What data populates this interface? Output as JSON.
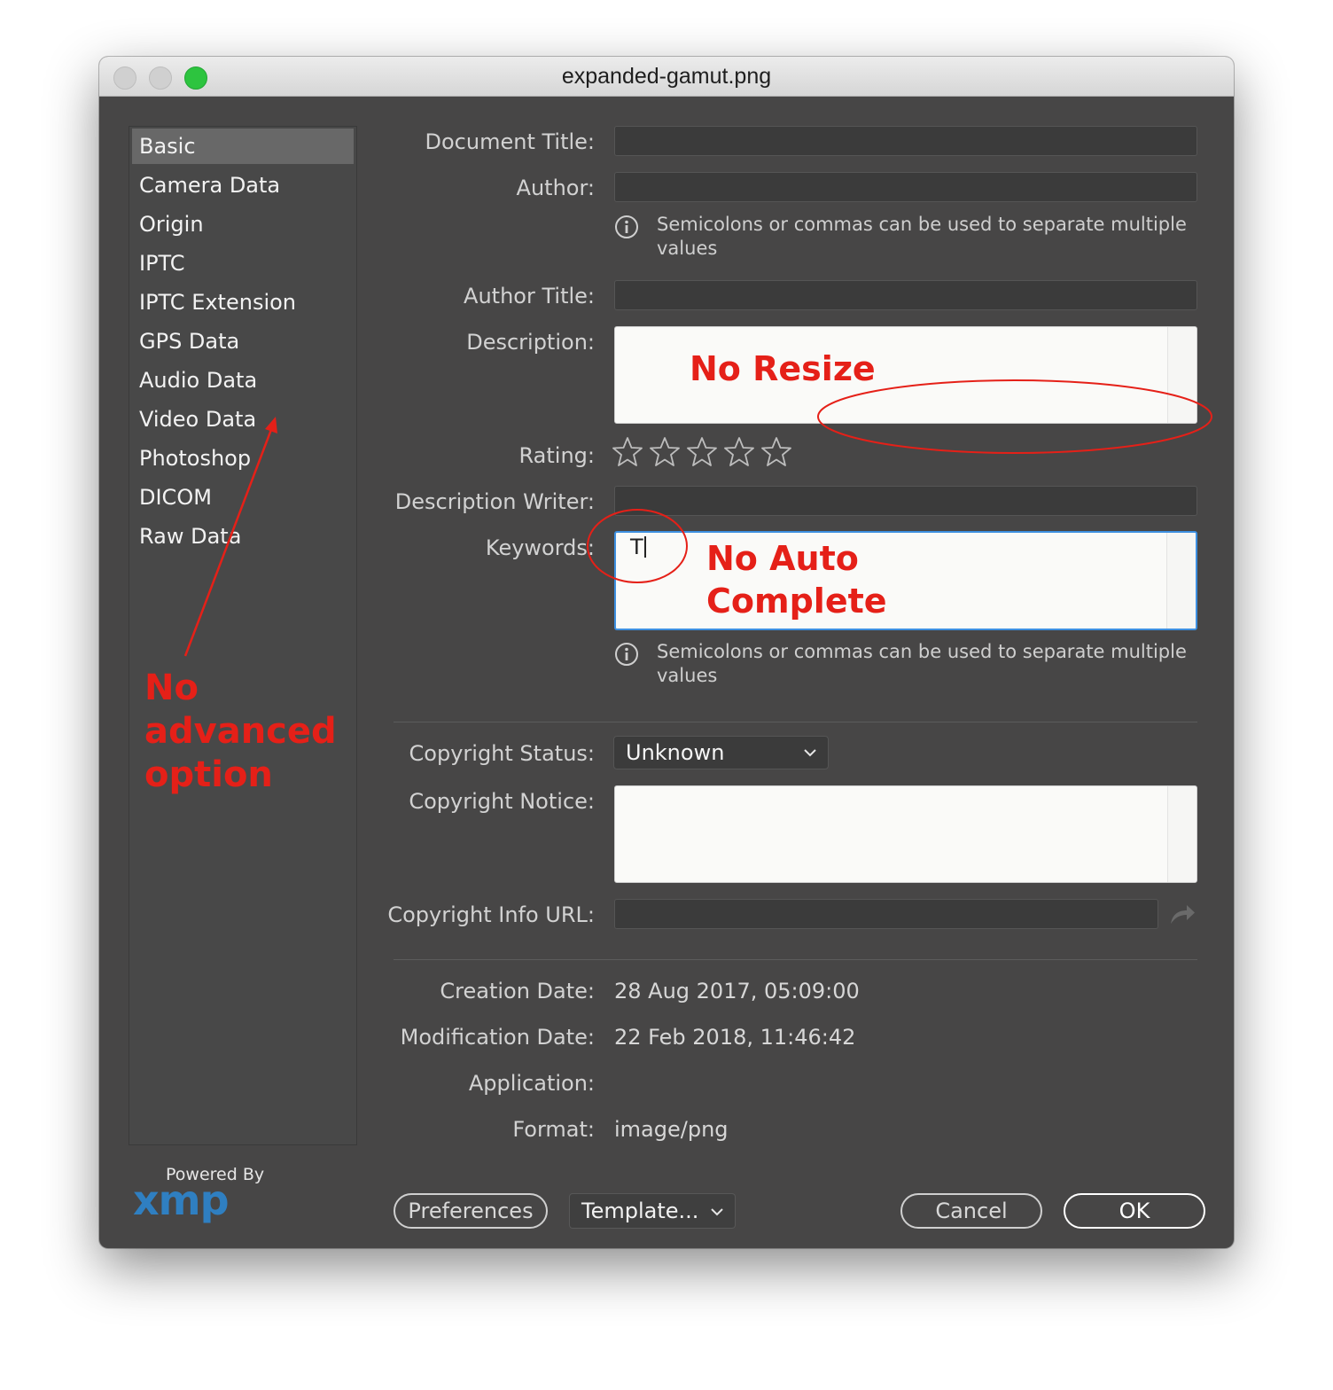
{
  "window": {
    "title": "expanded-gamut.png"
  },
  "sidebar": {
    "items": [
      {
        "label": "Basic"
      },
      {
        "label": "Camera Data"
      },
      {
        "label": "Origin"
      },
      {
        "label": "IPTC"
      },
      {
        "label": "IPTC Extension"
      },
      {
        "label": "GPS Data"
      },
      {
        "label": "Audio Data"
      },
      {
        "label": "Video Data"
      },
      {
        "label": "Photoshop"
      },
      {
        "label": "DICOM"
      },
      {
        "label": "Raw Data"
      }
    ],
    "selected_index": 0
  },
  "branding": {
    "powered_by": "Powered By",
    "logo_text": "xmp"
  },
  "fields": {
    "document_title": {
      "label": "Document Title:",
      "value": ""
    },
    "author": {
      "label": "Author:",
      "value": ""
    },
    "author_hint": "Semicolons or commas can be used to separate multiple values",
    "author_title": {
      "label": "Author Title:",
      "value": ""
    },
    "description": {
      "label": "Description:",
      "value": ""
    },
    "rating": {
      "label": "Rating:",
      "value": 0,
      "max": 5
    },
    "description_writer": {
      "label": "Description Writer:",
      "value": ""
    },
    "keywords": {
      "label": "Keywords:",
      "value": "T"
    },
    "keywords_hint": "Semicolons or commas can be used to separate multiple values",
    "copyright_status": {
      "label": "Copyright Status:",
      "value": "Unknown"
    },
    "copyright_notice": {
      "label": "Copyright Notice:",
      "value": ""
    },
    "copyright_url": {
      "label": "Copyright Info URL:",
      "value": ""
    }
  },
  "info": {
    "creation_date": {
      "label": "Creation Date:",
      "value": "28 Aug 2017, 05:09:00"
    },
    "modification_date": {
      "label": "Modification Date:",
      "value": "22 Feb 2018, 11:46:42"
    },
    "application": {
      "label": "Application:",
      "value": ""
    },
    "format": {
      "label": "Format:",
      "value": "image/png"
    }
  },
  "footer": {
    "preferences": "Preferences",
    "template": "Template...",
    "cancel": "Cancel",
    "ok": "OK"
  },
  "annotations": {
    "no_resize": "No Resize",
    "no_auto_complete_line1": "No Auto",
    "no_auto_complete_line2": "Complete",
    "no_advanced_line1": "No",
    "no_advanced_line2": "advanced",
    "no_advanced_line3": "option"
  },
  "colors": {
    "window_bg": "#474646",
    "annotation_red": "#e52018",
    "focus_blue": "#3d8fe0",
    "xmp_blue": "#2f7fc1",
    "zoom_green": "#2dc43f"
  }
}
